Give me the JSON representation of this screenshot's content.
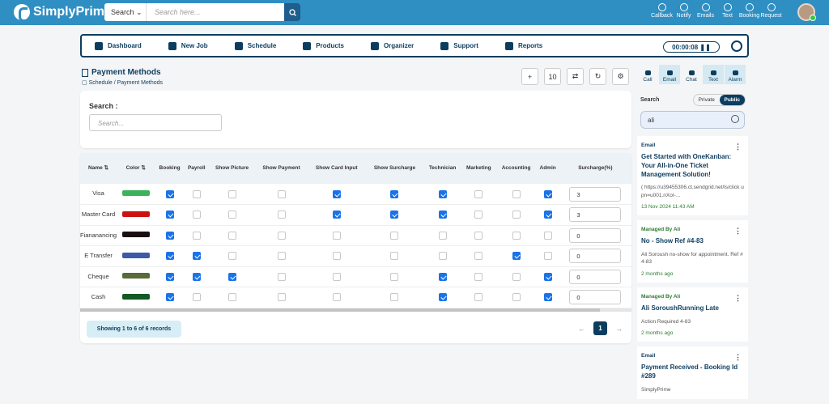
{
  "topbar": {
    "brand": "SimplyPrime",
    "search_select": "Search",
    "search_placeholder": "Search here...",
    "icons": [
      {
        "name": "callback",
        "label": "Callback"
      },
      {
        "name": "notify",
        "label": "Notify"
      },
      {
        "name": "emails",
        "label": "Emails"
      },
      {
        "name": "text",
        "label": "Text"
      },
      {
        "name": "booking",
        "label": "Booking"
      },
      {
        "name": "request",
        "label": "Request"
      }
    ]
  },
  "nav": {
    "items": [
      "Dashboard",
      "New Job",
      "Schedule",
      "Products",
      "Organizer",
      "Support",
      "Reports"
    ],
    "timer": "00:00:08"
  },
  "page": {
    "title": "Payment Methods",
    "crumb": "Schedule  /  Payment Methods",
    "page_size": "10"
  },
  "filter": {
    "label": "Search :",
    "placeholder": "Search..."
  },
  "table": {
    "headers": [
      "Name",
      "Color",
      "Booking",
      "Payroll",
      "Show Picture",
      "Show Payment",
      "Show Card Input",
      "Show Surcharge",
      "Technician",
      "Marketing",
      "Accounting",
      "Admin",
      "Surcharge(%)"
    ],
    "rows": [
      {
        "name": "Visa",
        "color": "#3cb35a",
        "checks": [
          1,
          0,
          0,
          0,
          1,
          1,
          1,
          0,
          0,
          1
        ],
        "surcharge": "3"
      },
      {
        "name": "Master Card",
        "color": "#cc1111",
        "checks": [
          1,
          0,
          0,
          0,
          1,
          1,
          1,
          0,
          0,
          1
        ],
        "surcharge": "3"
      },
      {
        "name": "Fiananancing",
        "color": "#1a0f0f",
        "checks": [
          1,
          0,
          0,
          0,
          0,
          0,
          0,
          0,
          0,
          0
        ],
        "surcharge": "0"
      },
      {
        "name": "E Transfer",
        "color": "#3d5aa8",
        "checks": [
          1,
          1,
          0,
          0,
          0,
          0,
          0,
          0,
          1,
          0
        ],
        "surcharge": "0"
      },
      {
        "name": "Cheque",
        "color": "#5a6a3a",
        "checks": [
          1,
          1,
          1,
          0,
          0,
          0,
          1,
          0,
          0,
          1
        ],
        "surcharge": "0"
      },
      {
        "name": "Cash",
        "color": "#145a22",
        "checks": [
          1,
          0,
          0,
          0,
          0,
          0,
          1,
          0,
          0,
          1
        ],
        "surcharge": "0"
      }
    ]
  },
  "footer": {
    "records": "Showing 1 to 6 of 6 records",
    "page": "1"
  },
  "right": {
    "tabs": [
      "Call",
      "Email",
      "Chat",
      "Text",
      "Alarm"
    ],
    "search_label": "Search",
    "toggle_private": "Private",
    "toggle_public": "Public",
    "search_value": "ali",
    "feed": [
      {
        "tag": "Email",
        "title": "Get Started with OneKanban: Your All-in-One Ticket Management Solution!",
        "body": "( https://u39455306.ct.sendgrid.net/ls/click upn=u001.nXoI-...",
        "time": "13 Nov 2024 11:43 AM"
      },
      {
        "tag": "Managed By Ali",
        "title": "No - Show Ref #4-83",
        "body": "Ali Soroush no-show for appointment. Ref #4-83",
        "time": "2 months ago"
      },
      {
        "tag": "Managed By Ali",
        "title": "Ali SoroushRunning Late",
        "body": "Action Required 4-83",
        "time": "2 months ago"
      },
      {
        "tag": "Email",
        "title": "Payment Received - Booking Id #289",
        "body": "SimplyPrime",
        "time": ""
      }
    ]
  }
}
